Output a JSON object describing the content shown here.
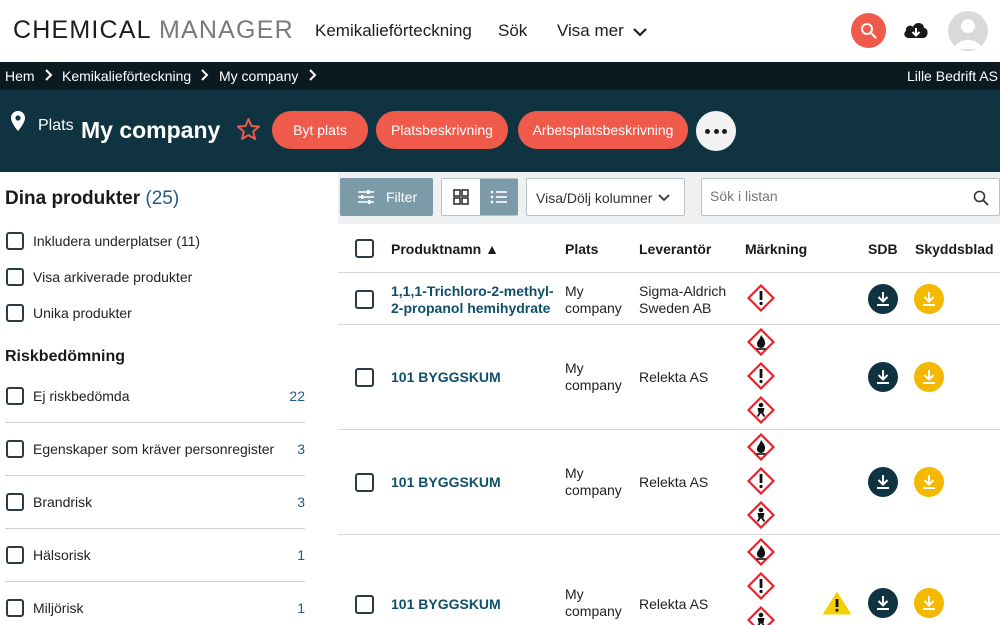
{
  "app": {
    "logo_part1": "CHEMICAL",
    "logo_part2": "MANAGER",
    "nav": [
      "Kemikalieförteckning",
      "Sök",
      "Visa mer"
    ],
    "accent": "#f05a4a",
    "dark": "#0f3340"
  },
  "breadcrumb": {
    "items": [
      "Hem",
      "Kemikalieförteckning",
      "My company"
    ],
    "company": "Lille Bedrift AS"
  },
  "location": {
    "label": "Plats",
    "title": "My company",
    "buttons": [
      "Byt plats",
      "Platsbeskrivning",
      "Arbetsplatsbeskrivning"
    ]
  },
  "sidebar": {
    "title": "Dina produkter",
    "count": "(25)",
    "options": [
      "Inkludera underplatser (11)",
      "Visa arkiverade produkter",
      "Unika produkter"
    ],
    "risk_title": "Riskbedömning",
    "risk_items": [
      {
        "label": "Ej riskbedömda",
        "count": "22"
      },
      {
        "label": "Egenskaper som kräver personregister",
        "count": "3"
      },
      {
        "label": "Brandrisk",
        "count": "3"
      },
      {
        "label": "Hälsorisk",
        "count": "1"
      },
      {
        "label": "Miljörisk",
        "count": "1"
      }
    ]
  },
  "toolbar": {
    "filter": "Filter",
    "columns": "Visa/Dölj kolumner",
    "search_placeholder": "Sök i listan"
  },
  "table": {
    "headers": [
      "Produktnamn ▲",
      "Plats",
      "Leverantör",
      "Märkning",
      "SDB",
      "Skyddsblad"
    ],
    "rows": [
      {
        "name_line1": "1,1,1-Trichloro-2-methyl-",
        "name_line2": "2-propanol hemihydrate",
        "place_line1": "My",
        "place_line2": "company",
        "supplier_line1": "Sigma-Aldrich",
        "supplier_line2": "Sweden AB",
        "pictograms": [
          "exclamation-icon"
        ],
        "warning": false
      },
      {
        "name_line1": "101 BYGGSKUM",
        "name_line2": "",
        "place_line1": "My",
        "place_line2": "company",
        "supplier_line1": "Relekta AS",
        "supplier_line2": "",
        "pictograms": [
          "flame-icon",
          "exclamation-icon",
          "health-hazard-icon"
        ],
        "warning": false
      },
      {
        "name_line1": "101 BYGGSKUM",
        "name_line2": "",
        "place_line1": "My",
        "place_line2": "company",
        "supplier_line1": "Relekta AS",
        "supplier_line2": "",
        "pictograms": [
          "flame-icon",
          "exclamation-icon",
          "health-hazard-icon"
        ],
        "warning": false
      },
      {
        "name_line1": "101 BYGGSKUM",
        "name_line2": "",
        "place_line1": "My",
        "place_line2": "company",
        "supplier_line1": "Relekta AS",
        "supplier_line2": "",
        "pictograms": [
          "flame-icon",
          "exclamation-icon",
          "health-hazard-icon"
        ],
        "warning": true
      }
    ]
  }
}
